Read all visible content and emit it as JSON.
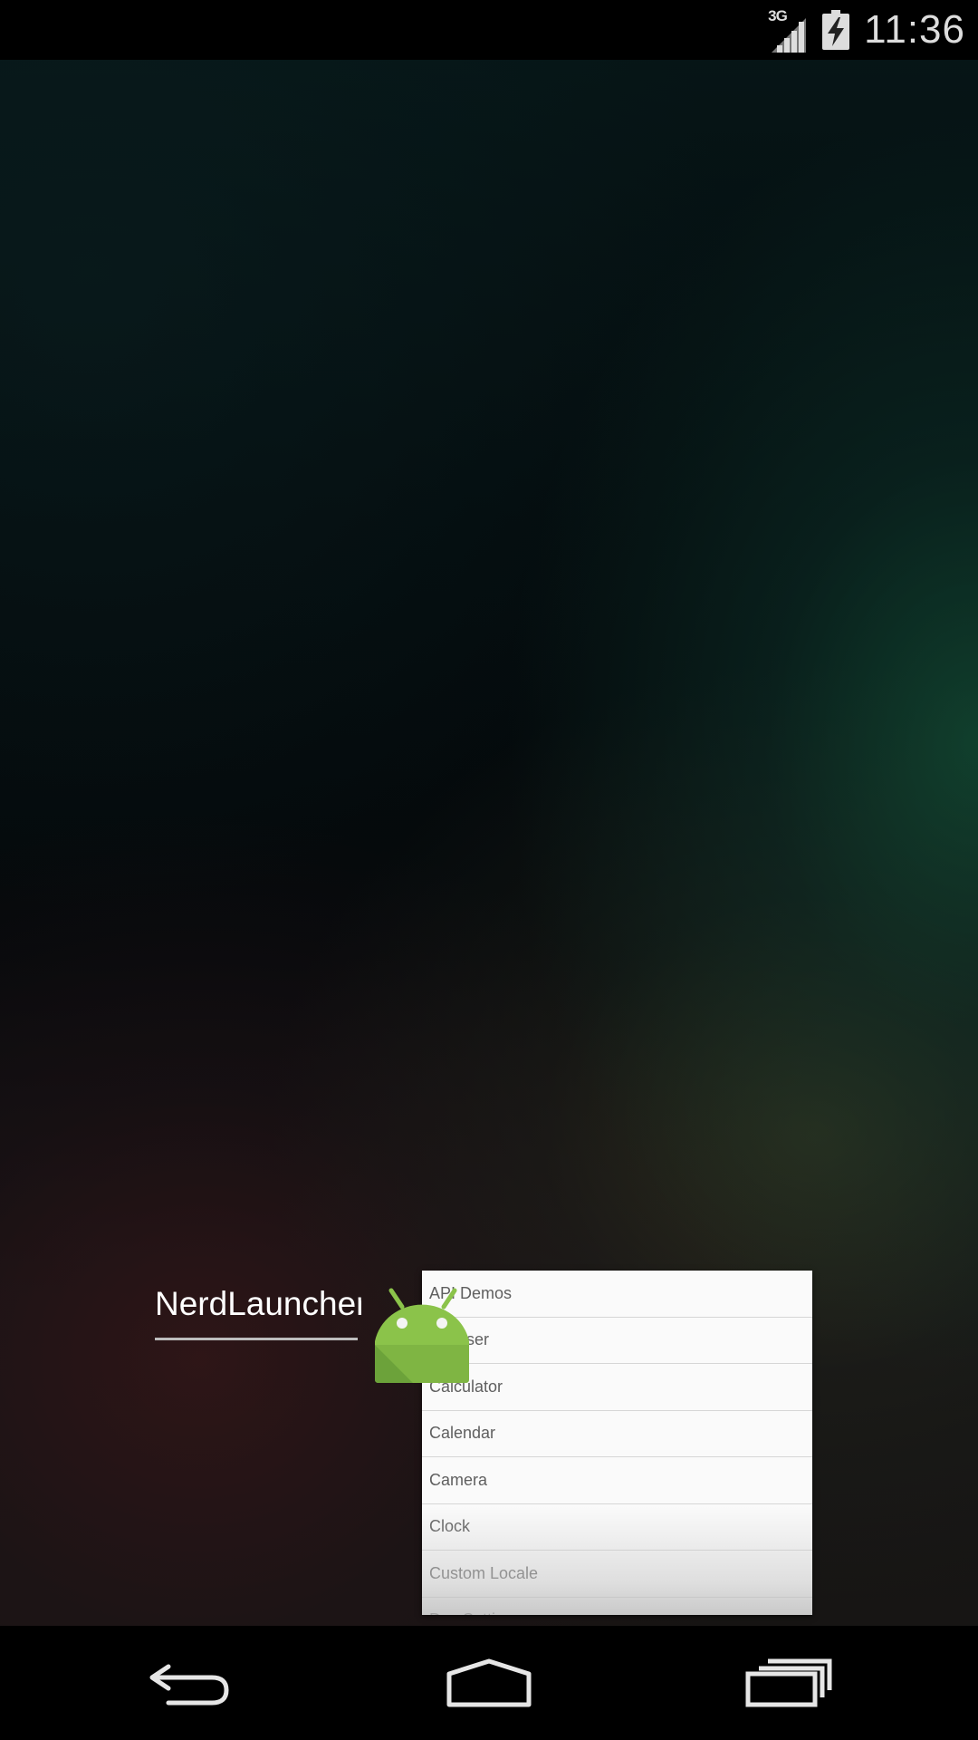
{
  "status_bar": {
    "network_type": "3G",
    "time": "11:36",
    "icons": [
      "signal-icon",
      "battery-charging-icon"
    ]
  },
  "widget": {
    "title": "NerdLauncher"
  },
  "app_list": {
    "items": [
      "API Demos",
      "Browser",
      "Calculator",
      "Calendar",
      "Camera",
      "Clock",
      "Custom Locale",
      "Dev Settings"
    ]
  },
  "drag_icon": {
    "name": "android-icon",
    "color": "#8BC34A"
  },
  "nav_bar": {
    "buttons": [
      "back-icon",
      "home-icon",
      "recents-icon"
    ]
  },
  "colors": {
    "status_bar_bg": "#000000",
    "list_bg": "#fafafa",
    "list_text": "#5f5f5f",
    "title_text": "#ffffff",
    "android_green": "#8BC34A"
  }
}
